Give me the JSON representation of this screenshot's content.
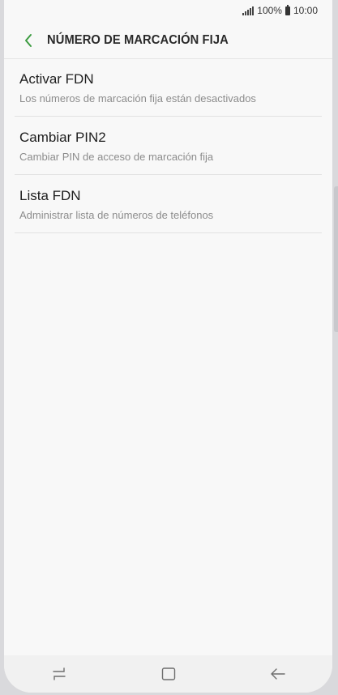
{
  "status_bar": {
    "battery_percent": "100%",
    "time": "10:00",
    "icons": [
      "signal-icon",
      "battery-icon"
    ]
  },
  "header": {
    "title": "NÚMERO DE MARCACIÓN FIJA",
    "back_icon": "chevron-left-icon"
  },
  "settings": {
    "items": [
      {
        "title": "Activar FDN",
        "subtitle": "Los números de marcación fija están desactivados"
      },
      {
        "title": "Cambiar PIN2",
        "subtitle": "Cambiar PIN de acceso de marcación fija"
      },
      {
        "title": "Lista FDN",
        "subtitle": "Administrar lista de números de teléfonos"
      }
    ]
  },
  "nav_bar": {
    "icons": [
      "recent-apps-icon",
      "home-icon",
      "back-icon"
    ]
  },
  "colors": {
    "accent": "#3d9c41",
    "background": "#f8f8f8",
    "title_text": "#1e1e1e",
    "subtitle_text": "#8c8c8c"
  }
}
